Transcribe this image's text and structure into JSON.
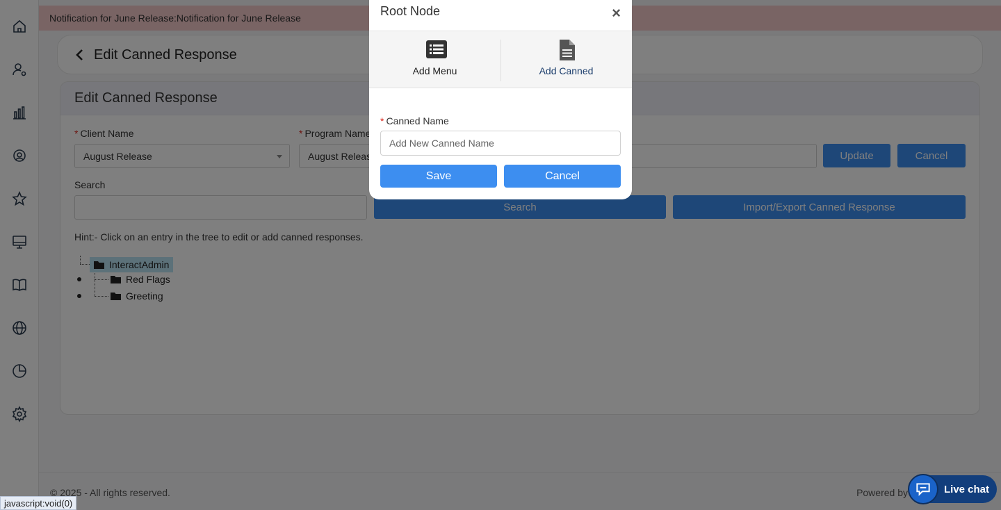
{
  "notification": "Notification for June Release:Notification for June Release",
  "header": {
    "title": "Edit Canned Response"
  },
  "card": {
    "title": "Edit Canned Response"
  },
  "form": {
    "client_label": "Client Name",
    "client_value": "August Release",
    "program_label": "Program Name",
    "program_value": "August Releas",
    "update_label": "Update",
    "cancel_label": "Cancel",
    "search_label": "Search",
    "search_button": "Search",
    "import_button": "Import/Export Canned Response",
    "hint": "Hint:- Click on an entry in the tree to edit or add canned responses."
  },
  "tree": {
    "root": "InteractAdmin",
    "children": [
      "Red Flags",
      "Greeting"
    ]
  },
  "footer": {
    "copyright": "© 2025 - All rights reserved.",
    "powered": "Powered by C"
  },
  "modal": {
    "title": "Root Node",
    "close": "×",
    "tabs": [
      {
        "label": "Add Menu",
        "icon": "list-icon"
      },
      {
        "label": "Add Canned",
        "icon": "document-icon"
      }
    ],
    "field_label": "Canned Name",
    "field_placeholder": "Add New Canned Name",
    "save_label": "Save",
    "cancel_label": "Cancel"
  },
  "statusbar": "javascript:void(0)",
  "livechat": {
    "label": "Live chat"
  },
  "colors": {
    "primary": "#3d8ef0",
    "notification": "#f3c9c9",
    "livechat": "#123e7c"
  }
}
